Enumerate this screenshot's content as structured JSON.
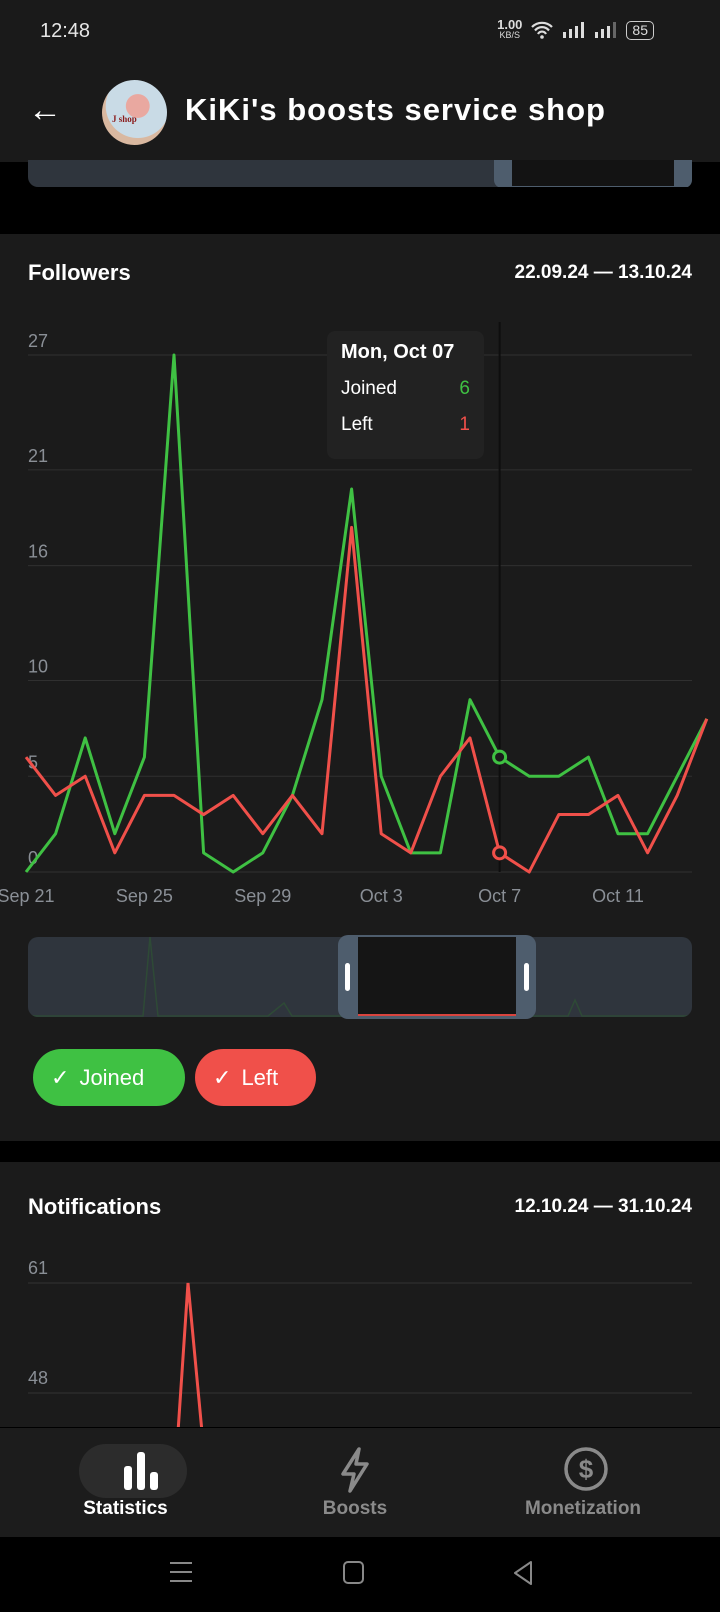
{
  "status_bar": {
    "time": "12:48",
    "net_speed": "1.00",
    "net_unit": "KB/S",
    "battery": "85"
  },
  "header": {
    "title": "KiKi's boosts service shop",
    "back_icon": "arrow-left-icon",
    "avatar_text": "J shop"
  },
  "colors": {
    "joined": "#3fc143",
    "left": "#f0504a",
    "background": "#1b1b1b"
  },
  "followers": {
    "title": "Followers",
    "range": "22.09.24 — 13.10.24",
    "tooltip": {
      "date": "Mon, Oct 07",
      "rows": [
        {
          "label": "Joined",
          "value": "6"
        },
        {
          "label": "Left",
          "value": "1"
        }
      ]
    },
    "legend": [
      {
        "label": "Joined",
        "checked": true
      },
      {
        "label": "Left",
        "checked": true
      }
    ]
  },
  "notifications": {
    "title": "Notifications",
    "range": "12.10.24 — 31.10.24"
  },
  "chart_data": [
    {
      "type": "line",
      "title": "Followers",
      "x": [
        "Sep 21",
        "Sep 22",
        "Sep 23",
        "Sep 24",
        "Sep 25",
        "Sep 26",
        "Sep 27",
        "Sep 28",
        "Sep 29",
        "Sep 30",
        "Oct 1",
        "Oct 2",
        "Oct 3",
        "Oct 4",
        "Oct 5",
        "Oct 6",
        "Oct 7",
        "Oct 8",
        "Oct 9",
        "Oct 10",
        "Oct 11",
        "Oct 12",
        "Oct 13",
        "Oct 14"
      ],
      "x_tick_labels": [
        "Sep 21",
        "Sep 25",
        "Sep 29",
        "Oct 3",
        "Oct 7",
        "Oct 11"
      ],
      "y_tick_labels": [
        "0",
        "5",
        "10",
        "16",
        "21",
        "27"
      ],
      "ylim": [
        0,
        27
      ],
      "grid": true,
      "highlight": "Oct 7",
      "series": [
        {
          "name": "Joined",
          "color": "#3fc143",
          "values": [
            0,
            2,
            7,
            2,
            6,
            27,
            1,
            0,
            1,
            4,
            9,
            20,
            5,
            1,
            1,
            9,
            6,
            5,
            5,
            6,
            2,
            2,
            5,
            8
          ]
        },
        {
          "name": "Left",
          "color": "#f0504a",
          "values": [
            6,
            4,
            5,
            1,
            4,
            4,
            3,
            4,
            2,
            4,
            2,
            18,
            2,
            1,
            5,
            7,
            1,
            0,
            3,
            3,
            4,
            1,
            4,
            8
          ]
        }
      ]
    },
    {
      "type": "line",
      "title": "Notifications",
      "y_tick_labels": [
        "48",
        "61"
      ],
      "grid": true,
      "series": [
        {
          "color": "#f0504a",
          "peak": 61
        }
      ]
    }
  ],
  "bottom_nav": [
    {
      "label": "Statistics",
      "icon": "bar-chart-icon",
      "active": true
    },
    {
      "label": "Boosts",
      "icon": "lightning-icon",
      "active": false
    },
    {
      "label": "Monetization",
      "icon": "dollar-circle-icon",
      "active": false
    }
  ]
}
